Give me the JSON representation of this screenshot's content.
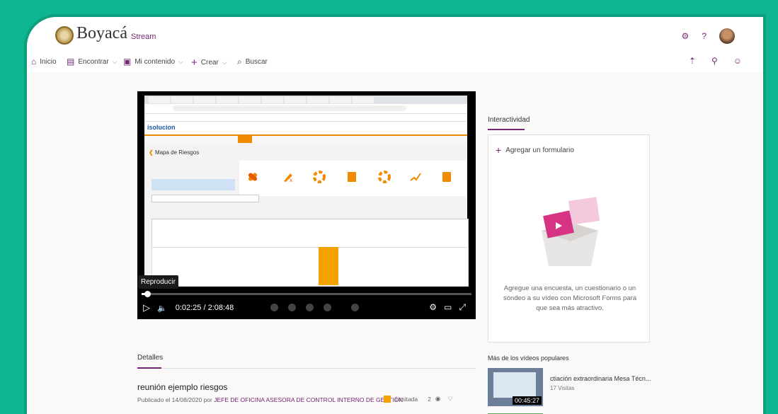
{
  "brand": {
    "name": "Boyacá",
    "app": "Stream"
  },
  "nav": {
    "home": "Inicio",
    "discover": "Encontrar",
    "my_content": "Mi contenido",
    "create": "Crear",
    "search": "Buscar"
  },
  "player": {
    "tooltip": "Reproducir",
    "current_time": "0:02:25",
    "duration": "2:08:48",
    "progress_fraction": 0.02
  },
  "screen": {
    "app_logo": "isolucion",
    "panel_title": "Mapa de Riesgos"
  },
  "side": {
    "title": "Interactividad",
    "add_form": "Agregar un formulario",
    "description": "Agregue una encuesta, un cuestionario o un sondeo a su vídeo con Microsoft Forms para que sea más atractivo."
  },
  "details": {
    "title": "Detalles",
    "video_title": "reunión ejemplo riesgos",
    "published_prefix": "Publicado el 14/08/2020 por ",
    "author": "JEFE DE OFICINA ASESORA DE CONTROL INTERNO DE GESTIÓN",
    "visibility": "Limitada",
    "views": "2",
    "likes": ""
  },
  "popular": {
    "title": "Más de los vídeos populares",
    "items": [
      {
        "title": "ctiación extraordinaria Mesa Técn...",
        "views": "17 Visitas",
        "duration": "00:45:27"
      }
    ]
  },
  "colors": {
    "accent": "#742774",
    "frame": "#0fb58f",
    "orange": "#f5a100"
  }
}
